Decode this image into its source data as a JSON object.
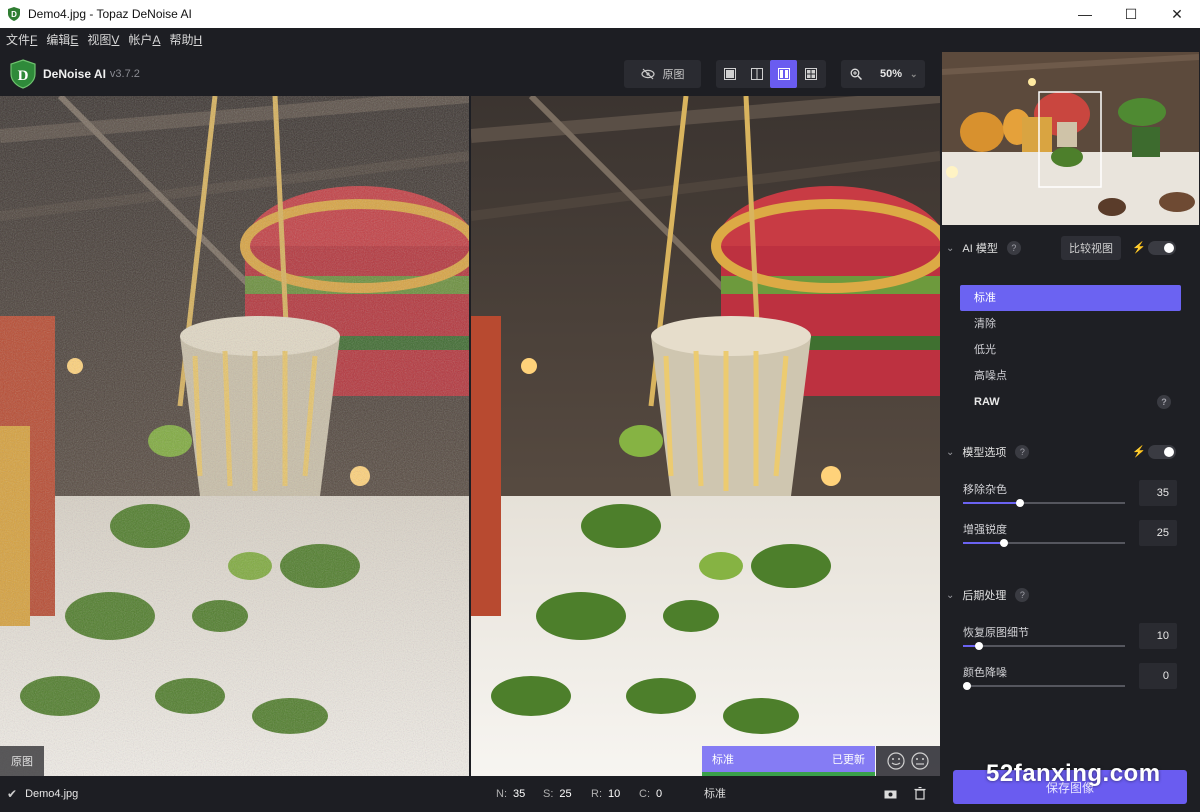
{
  "window": {
    "title": "Demo4.jpg - Topaz DeNoise AI",
    "controls": {
      "minimize": "—",
      "maximize": "☐",
      "close": "✕"
    }
  },
  "menu": [
    {
      "label": "文件",
      "key": "F"
    },
    {
      "label": "编辑",
      "key": "E"
    },
    {
      "label": "视图",
      "key": "V"
    },
    {
      "label": "帐户",
      "key": "A"
    },
    {
      "label": "帮助",
      "key": "H"
    }
  ],
  "toolbar": {
    "app_name": "DeNoise AI",
    "version": "v3.7.2",
    "original_label": "原图",
    "zoom": "50%",
    "active_view": "side-by-side"
  },
  "preview": {
    "left_label": "原图",
    "right_model": "标准",
    "right_status": "已更新"
  },
  "status": {
    "filename": "Demo4.jpg",
    "n_label": "N:",
    "n_value": "35",
    "s_label": "S:",
    "s_value": "25",
    "r_label": "R:",
    "r_value": "10",
    "c_label": "C:",
    "c_value": "0",
    "model": "标准"
  },
  "panel": {
    "ai_model": {
      "title": "AI 模型",
      "compare_label": "比较视图",
      "items": [
        {
          "label": "标准",
          "selected": true
        },
        {
          "label": "清除",
          "selected": false
        },
        {
          "label": "低光",
          "selected": false
        },
        {
          "label": "高噪点",
          "selected": false
        },
        {
          "label": "RAW",
          "selected": false
        }
      ]
    },
    "model_options": {
      "title": "模型选项",
      "sliders": [
        {
          "label": "移除杂色",
          "value": "35",
          "fraction": 0.35
        },
        {
          "label": "增强锐度",
          "value": "25",
          "fraction": 0.25
        }
      ]
    },
    "post": {
      "title": "后期处理",
      "sliders": [
        {
          "label": "恢复原图细节",
          "value": "10",
          "fraction": 0.1
        },
        {
          "label": "颜色降噪",
          "value": "0",
          "fraction": 0.0
        }
      ]
    },
    "save_label": "保存图像",
    "watermark": "52fanxing.com"
  },
  "colors": {
    "accent": "#6a5cf0",
    "background": "#1e1f24",
    "status_green": "#3aa04a"
  }
}
